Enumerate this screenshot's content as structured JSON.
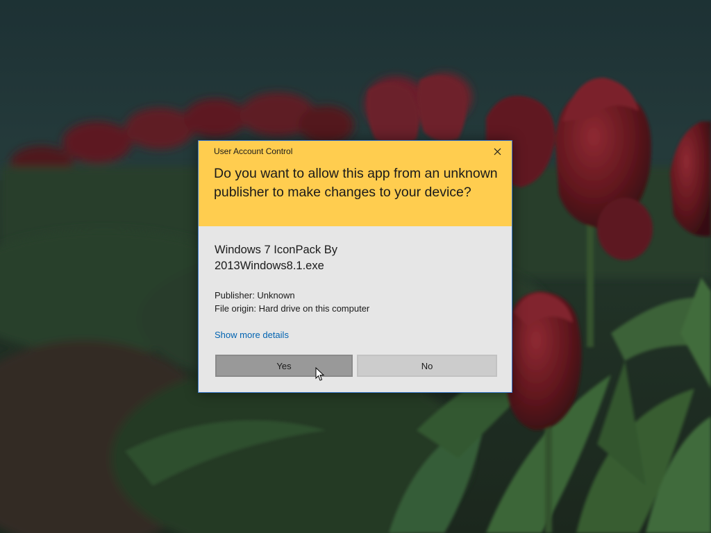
{
  "dialog": {
    "caption": "User Account Control",
    "question": "Do you want to allow this app from an unknown publisher to make changes to your device?",
    "app_name": "Windows 7 IconPack By 2013Windows8.1.exe",
    "publisher": "Publisher: Unknown",
    "file_origin": "File origin: Hard drive on this computer",
    "more_details_link": "Show more details",
    "yes_label": "Yes",
    "no_label": "No",
    "close_icon": "close-icon"
  },
  "colors": {
    "header_bg": "#ffcd4f",
    "body_bg": "#e6e6e6",
    "link": "#0063b1",
    "yes_button": "#999999",
    "no_button": "#cccccc",
    "dialog_border": "#3b7bd0"
  },
  "wallpaper": {
    "subject": "red tulips"
  }
}
